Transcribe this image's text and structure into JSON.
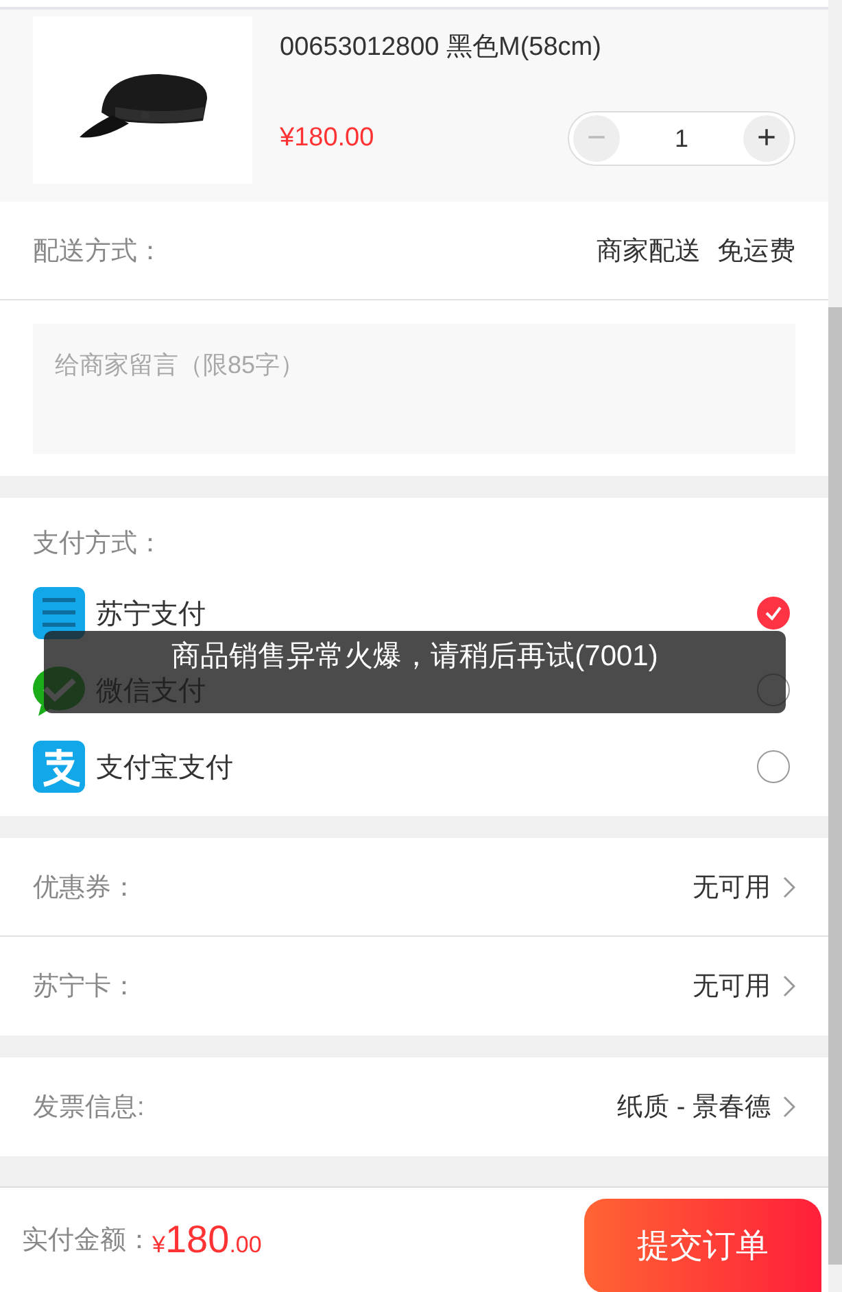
{
  "product": {
    "title": "00653012800 黑色M(58cm)",
    "price": "¥180.00",
    "quantity": "1",
    "minus": "−",
    "plus": "+"
  },
  "delivery": {
    "label": "配送方式：",
    "values": [
      "商家配送",
      "免运费"
    ]
  },
  "message": {
    "placeholder": "给商家留言（限85字）"
  },
  "payment": {
    "label": "支付方式：",
    "methods": [
      {
        "name": "苏宁支付",
        "kind": "suning",
        "selected": true
      },
      {
        "name": "微信支付",
        "kind": "wechat",
        "selected": false
      },
      {
        "name": "支付宝支付",
        "kind": "alipay",
        "selected": false
      }
    ]
  },
  "groups": [
    [
      {
        "label": "优惠券：",
        "value": "无可用"
      },
      {
        "label": "苏宁卡：",
        "value": "无可用"
      }
    ],
    [
      {
        "label": "发票信息:",
        "value": "纸质 - 景春德"
      }
    ]
  ],
  "footer": {
    "label": "实付金额：",
    "currency": "¥",
    "amount": "180",
    "cents": ".00",
    "submit": "提交订单"
  },
  "toast": "商品销售异常火爆，请稍后再试(7001)"
}
